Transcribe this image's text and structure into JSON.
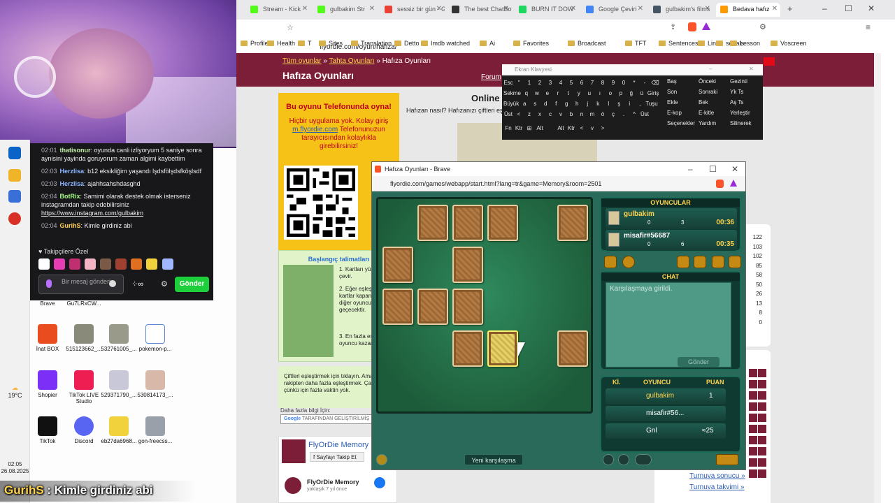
{
  "stream": {
    "chat_messages": [
      {
        "time": "02:01",
        "user": "thatisonur",
        "user_color": "#c4f0a9",
        "text": "oyunda canli izliyoryum 5 saniye sonra aynisini yayinda goruyorum zaman algimi kaybettim"
      },
      {
        "time": "02:03",
        "user": "Herzlisa",
        "user_color": "#8ab4ff",
        "text": "b12 eksikliğim yaşandı lşdsfölşdsfköşlsdf"
      },
      {
        "time": "02:03",
        "user": "Herzlisa",
        "user_color": "#8ab4ff",
        "text": "ajahhsahshdasghd"
      },
      {
        "time": "02:04",
        "user": "BotRix",
        "user_color": "#a7ff83",
        "text": "Samimi olarak destek olmak isterseniz instagramdan takip edebilirsiniz",
        "link": "https://www.instagram.com/gulbakim"
      },
      {
        "time": "02:04",
        "user": "GurihS",
        "user_color": "#ffcf5c",
        "text": "Kimle girdiniz abi"
      }
    ],
    "followers_label": "Takipçilere Özel",
    "message_placeholder": "Bir mesaj gönderin",
    "send_label": "Gönder",
    "overlay_user": "GurihS",
    "overlay_text": "Kimle girdiniz abi"
  },
  "desktop": {
    "icons_row0": [
      {
        "label": "Brave"
      },
      {
        "label": "Gu7LRxCW..."
      }
    ],
    "icons_row1": [
      {
        "label": "İnat BOX"
      },
      {
        "label": "515123662_..."
      },
      {
        "label": "532761005_..."
      },
      {
        "label": "pokemon-p..."
      }
    ],
    "icons_row2": [
      {
        "label": "Shopier"
      },
      {
        "label": "TikTok LIVE Studio"
      },
      {
        "label": "529371790_..."
      },
      {
        "label": "530814173_..."
      }
    ],
    "icons_row3": [
      {
        "label": "TikTok"
      },
      {
        "label": "Discord"
      },
      {
        "label": "eb27da6968..."
      },
      {
        "label": "gon-freecss..."
      }
    ],
    "weather": "19°C",
    "clock_time": "02:05",
    "clock_date": "26.08.2025"
  },
  "browser": {
    "tabs": [
      {
        "label": "Stream - Kick",
        "color": "#53fc18"
      },
      {
        "label": "gulbakim Str",
        "color": "#53fc18"
      },
      {
        "label": "sessiz bir gün - G",
        "color": "#e94235"
      },
      {
        "label": "The best ChatBot",
        "color": "#333333"
      },
      {
        "label": "BURN IT DOW",
        "color": "#1ed760"
      },
      {
        "label": "Google Çeviri",
        "color": "#4285f4"
      },
      {
        "label": "gulbakim's films",
        "color": "#445566"
      },
      {
        "label": "Bedava hafız",
        "color": "#ff9900"
      }
    ],
    "url": "flyordie.com/oyun/hafiza/",
    "bookmarks": [
      "Profile",
      "Health",
      "T",
      "Sites",
      "Translation",
      "Detto",
      "Imdb watched",
      "Ai",
      "Favorites",
      "Broadcast",
      "TFT",
      "Sentences",
      "Links",
      "serials",
      "Lesson",
      "Voscreen"
    ]
  },
  "site": {
    "crumb_1": "Tüm oyunlar",
    "crumb_2": "Tahta Oyunları",
    "crumb_3": "Hafıza Oyunları",
    "title": "Hafıza Oyunları",
    "forum": "Forum",
    "promo_title": "Bu oyunu Telefonunda oyna!",
    "promo_text_1": "Hiçbir uygulama yok. Kolay giriş",
    "promo_link": "m.flyordie.com",
    "promo_text_2": "Telefonunuzun tarayıcısından kolaylıkla girebilirsiniz!",
    "instructions_title": "Başlangıç talimatları",
    "instr_1": "Kartları yüzlerini çevir.",
    "instr_2": "Eğer eşleşmezse kartlar kapanır ve sıra diğer oyuncuya geçecektir.",
    "instr_3": "En fazla eşleştiren oyuncu kazanır.",
    "hint": "Çiftleri eşleştirmek için tıklayın. Amaç rakipten daha fazla eşleştirmek. Çabuk yap, çünkü için fazla vaktin yok.",
    "more_info": "Daha fazla bilgi İçin:",
    "search_label": "TARAFINDAN GELİŞTİRİLMİŞ",
    "fb_name": "FlyOrDie Memory",
    "fb_follow": "Sayfayı Takip Et",
    "fb_post_name": "FlyOrDie Memory",
    "fb_post_time": "yaklaşık 7 yıl önce",
    "online_heading": "Online",
    "online_text": "Hafızan nasıl? Hafızanızı çiftleri eş",
    "right_numbers": [
      "122",
      "103",
      "102",
      "85",
      "58",
      "50",
      "26",
      "13",
      "8",
      "0"
    ],
    "tournament_links": [
      "Turnuva sonucu »",
      "Turnuva takvimi »"
    ]
  },
  "keyboard": {
    "title": "Ekran Klavyesi",
    "rows": [
      [
        "Esc",
        "\"",
        "1",
        "2",
        "3",
        "4",
        "5",
        "6",
        "7",
        "8",
        "9",
        "0",
        "*",
        "-",
        "⌫"
      ],
      [
        "Sekme",
        "q",
        "w",
        "e",
        "r",
        "t",
        "y",
        "u",
        "ı",
        "o",
        "p",
        "ğ",
        "ü",
        "Giriş"
      ],
      [
        "Büyük",
        "a",
        "s",
        "d",
        "f",
        "g",
        "h",
        "j",
        "k",
        "l",
        "ş",
        "i",
        ",",
        "Tuşu"
      ],
      [
        "Üst",
        "<",
        "z",
        "x",
        "c",
        "v",
        "b",
        "n",
        "m",
        "ö",
        "ç",
        ".",
        "^",
        "Üst"
      ],
      [
        "Fn",
        "Ktr",
        "⊞",
        "Alt",
        "",
        "Alt",
        "Ktr",
        "<",
        "v",
        ">"
      ]
    ],
    "side": [
      "Baş",
      "Önceki",
      "Gezinti",
      "Son",
      "Sonraki",
      "Yk Ts",
      "Ekle",
      "Bek",
      "Aş Ts",
      "E-kop",
      "E-kitle",
      "Yerleştir",
      "Seçenekler",
      "Yardım",
      "Silinerek"
    ]
  },
  "game": {
    "window_title": "Hafıza Oyunları - Brave",
    "url": "flyordie.com/games/webapp/start.html?lang=tr&game=Memory&room=2501",
    "players_header": "OYUNCULAR",
    "players": [
      {
        "name": "gulbakim",
        "a": "0",
        "b": "3",
        "time": "00:36"
      },
      {
        "name": "misafir#56687",
        "a": "0",
        "b": "6",
        "time": "00:35"
      }
    ],
    "chat_header": "CHAT",
    "chat_text": "Karşılaşmaya girildi.",
    "send_label": "Gönder",
    "rank_headers": {
      "ki": "Kİ.",
      "player": "OYUNCU",
      "points": "PUAN"
    },
    "ranking": [
      {
        "name": "gulbakim",
        "points": "1"
      },
      {
        "name": "misafir#56...",
        "points": ""
      },
      {
        "name": "Gnl",
        "points": "≈25"
      }
    ],
    "new_match": "Yeni karşılaşma",
    "cards": [
      {
        "row": 0,
        "col": 1
      },
      {
        "row": 0,
        "col": 2
      },
      {
        "row": 0,
        "col": 3
      },
      {
        "row": 0,
        "col": 5
      },
      {
        "row": 1,
        "col": 0
      },
      {
        "row": 1,
        "col": 2
      },
      {
        "row": 2,
        "col": 0
      },
      {
        "row": 2,
        "col": 1
      },
      {
        "row": 2,
        "col": 2
      },
      {
        "row": 3,
        "col": 2
      },
      {
        "row": 3,
        "col": 3,
        "selected": true
      },
      {
        "row": 3,
        "col": 5
      }
    ]
  },
  "colors": {
    "site_brand": "#7c1e37",
    "game_bg": "#2a6a5a",
    "kick_green": "#53fc18"
  }
}
